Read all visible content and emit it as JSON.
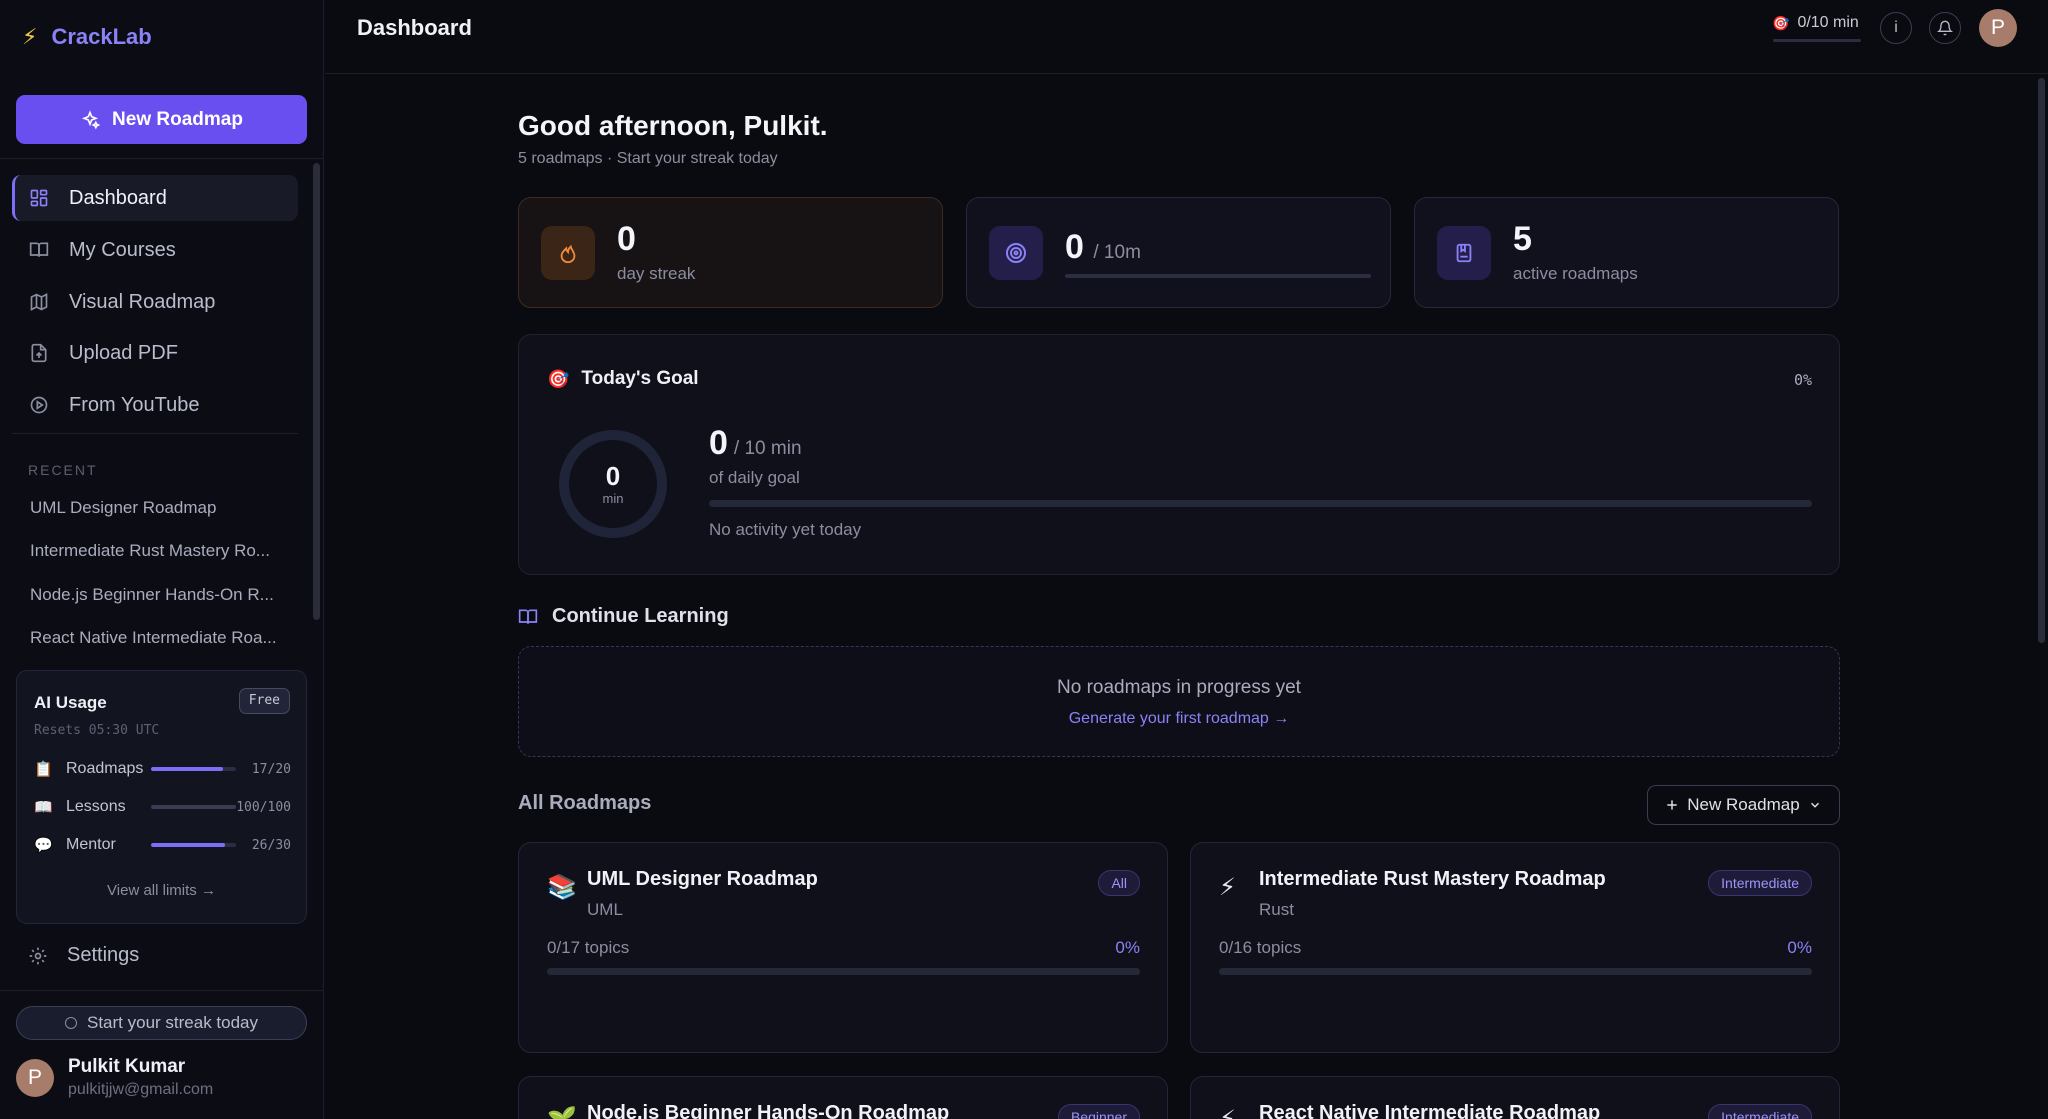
{
  "brand": {
    "name": "CrackLab"
  },
  "sidebar": {
    "new_roadmap_label": "New Roadmap",
    "nav": [
      {
        "label": "Dashboard",
        "icon": "dashboard-grid-icon",
        "active": true
      },
      {
        "label": "My Courses",
        "icon": "book-open-icon"
      },
      {
        "label": "Visual Roadmap",
        "icon": "map-icon"
      },
      {
        "label": "Upload PDF",
        "icon": "file-upload-icon"
      },
      {
        "label": "From YouTube",
        "icon": "play-circle-icon"
      }
    ],
    "recent_title": "RECENT",
    "recent": [
      "UML Designer Roadmap",
      "Intermediate Rust Mastery Ro...",
      "Node.js Beginner Hands-On R...",
      "React Native Intermediate Roa..."
    ],
    "ai_usage": {
      "title": "AI Usage",
      "plan": "Free",
      "resets": "Resets 05:30 UTC",
      "rows": [
        {
          "icon": "📋",
          "label": "Roadmaps",
          "value": "17/20",
          "fraction": 0.85
        },
        {
          "icon": "📖",
          "label": "Lessons",
          "value": "100/100",
          "fraction": 1.0
        },
        {
          "icon": "💬",
          "label": "Mentor",
          "value": "26/30",
          "fraction": 0.867
        }
      ],
      "view_all": "View all limits →"
    },
    "settings_label": "Settings",
    "streak_pill": "Start your streak today",
    "user": {
      "initial": "P",
      "name": "Pulkit Kumar",
      "email": "pulkitjjw@gmail.com"
    }
  },
  "topbar": {
    "title": "Dashboard",
    "timer_icon": "🎯",
    "timer": "0/10 min",
    "info_label": "i",
    "avatar_initial": "P"
  },
  "main": {
    "greeting": "Good afternoon, Pulkit.",
    "greeting_sub": "5 roadmaps · Start your streak today",
    "stats": {
      "streak": {
        "value": "0",
        "label": "day streak"
      },
      "minutes": {
        "value": "0",
        "suffix": "/ 10m",
        "progress": 0
      },
      "roadmaps": {
        "value": "5",
        "label": "active roadmaps"
      }
    },
    "goal": {
      "icon": "🎯",
      "title": "Today's Goal",
      "percent": "0%",
      "ring_value": "0",
      "ring_unit": "min",
      "value": "0",
      "suffix": "/ 10 min",
      "of_label": "of daily goal",
      "progress": 0,
      "status": "No activity yet today"
    },
    "continue": {
      "title": "Continue Learning",
      "empty_title": "No roadmaps in progress yet",
      "empty_link": "Generate your first roadmap →"
    },
    "all_roadmaps": {
      "title": "All Roadmaps",
      "new_button": "New Roadmap",
      "cards": [
        {
          "icon": "📚",
          "title": "UML Designer Roadmap",
          "subject": "UML",
          "badge": "All",
          "topics": "0/17 topics",
          "percent": "0%"
        },
        {
          "icon": "⚡",
          "title": "Intermediate Rust Mastery Roadmap",
          "subject": "Rust",
          "badge": "Intermediate",
          "topics": "0/16 topics",
          "percent": "0%"
        },
        {
          "icon": "🌱",
          "title": "Node.js Beginner Hands-On Roadmap",
          "subject": "",
          "badge": "Beginner",
          "topics": "",
          "percent": ""
        },
        {
          "icon": "⚡",
          "title": "React Native Intermediate Roadmap",
          "subject": "",
          "badge": "Intermediate",
          "topics": "",
          "percent": ""
        }
      ]
    }
  },
  "colors": {
    "accent": "#6a4ff0",
    "accent_text": "#8a82f6",
    "background": "#0a0b11",
    "streak_tint": "#f08a3c"
  }
}
